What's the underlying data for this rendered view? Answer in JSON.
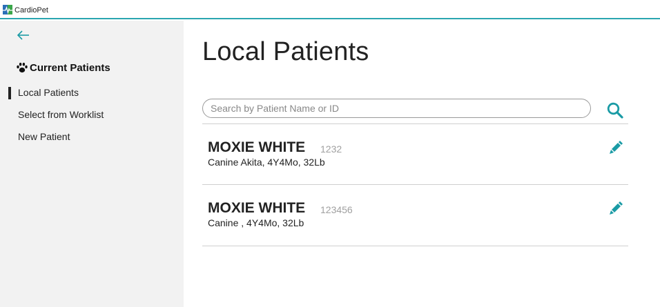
{
  "app": {
    "title": "CardioPet"
  },
  "sidebar": {
    "section_label": "Current Patients",
    "items": [
      {
        "label": "Local Patients",
        "active": true
      },
      {
        "label": "Select from Worklist",
        "active": false
      },
      {
        "label": "New Patient",
        "active": false
      }
    ]
  },
  "main": {
    "title": "Local Patients",
    "search": {
      "placeholder": "Search by Patient Name or ID",
      "value": ""
    },
    "patients": [
      {
        "name": "MOXIE WHITE",
        "id": "1232",
        "details": "Canine Akita, 4Y4Mo, 32Lb"
      },
      {
        "name": "MOXIE WHITE",
        "id": "123456",
        "details": "Canine , 4Y4Mo, 32Lb"
      }
    ]
  },
  "colors": {
    "accent": "#1a9ba5",
    "sidebar_bg": "#f2f2f2",
    "divider": "#cfcfcf"
  },
  "icons": {
    "back": "arrow-left-icon",
    "section": "paw-icon",
    "search": "search-icon",
    "edit": "pencil-icon"
  }
}
